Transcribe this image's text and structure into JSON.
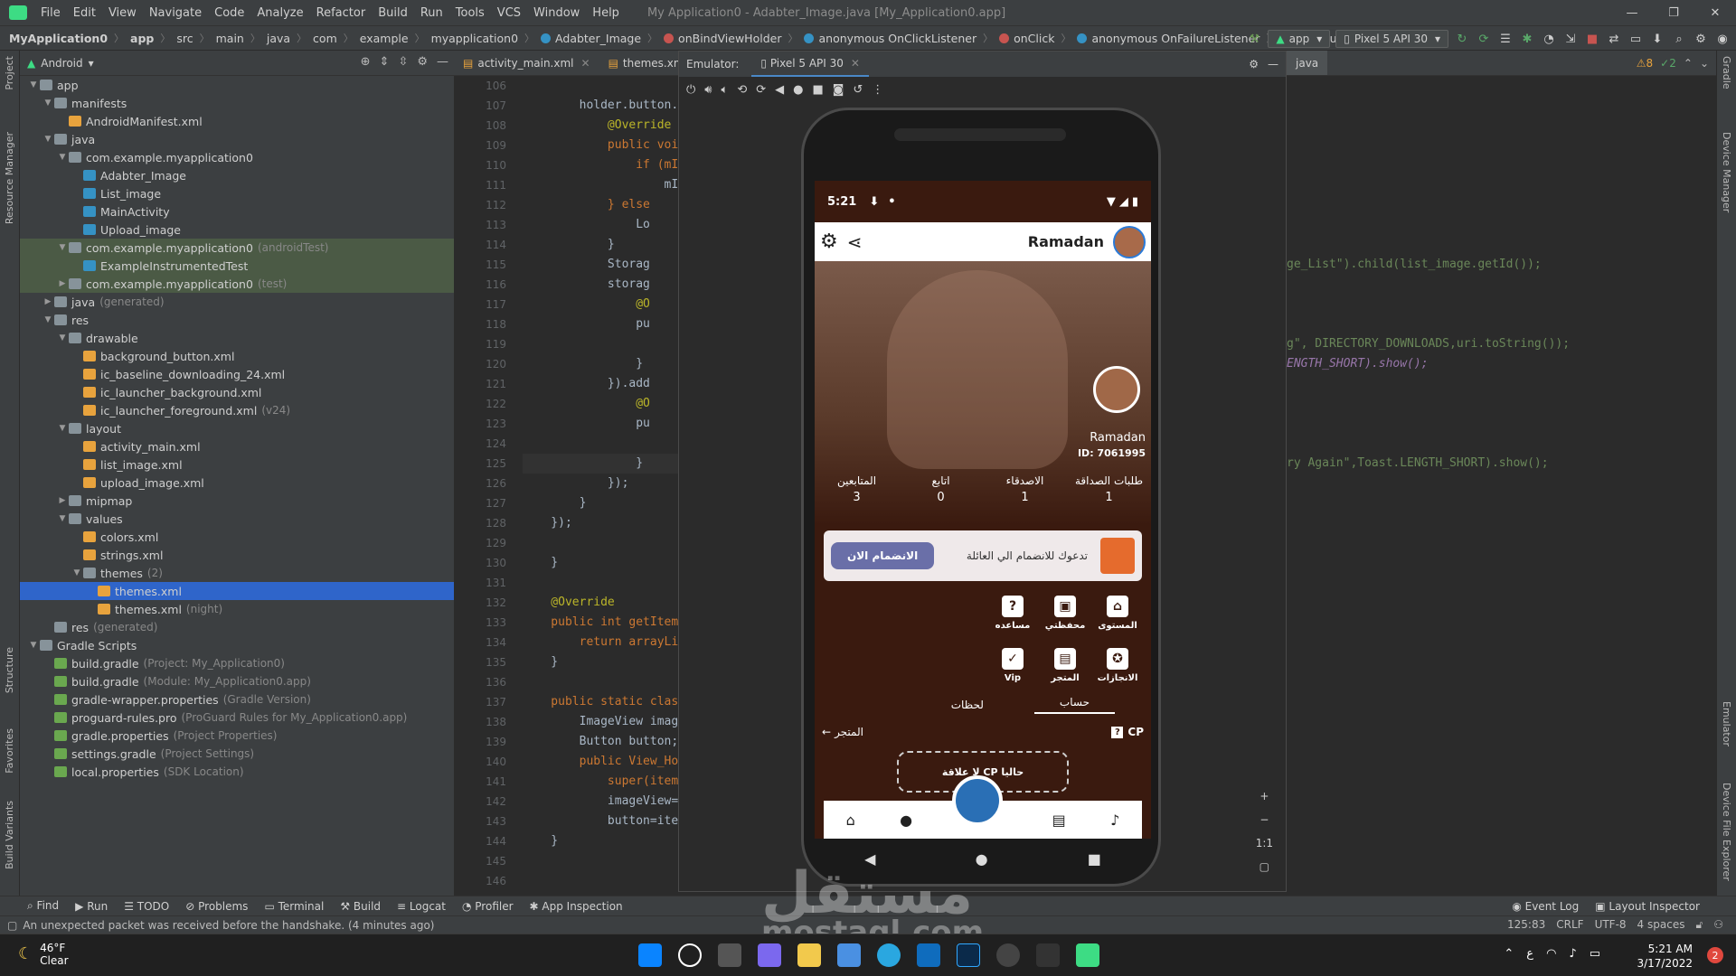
{
  "menubar": {
    "items": [
      "File",
      "Edit",
      "View",
      "Navigate",
      "Code",
      "Analyze",
      "Refactor",
      "Build",
      "Run",
      "Tools",
      "VCS",
      "Window",
      "Help"
    ],
    "window_title": "My Application0 - Adabter_Image.java [My_Application0.app]"
  },
  "breadcrumbs": [
    "MyApplication0",
    "app",
    "src",
    "main",
    "java",
    "com",
    "example",
    "myapplication0",
    "Adabter_Image",
    "onBindViewHolder",
    "anonymous OnClickListener",
    "onClick",
    "anonymous OnFailureListener",
    "onFailure"
  ],
  "toolbar": {
    "module": "app",
    "device": "Pixel 5 API 30"
  },
  "project_panel": {
    "mode": "Android",
    "tree": [
      {
        "label": "app",
        "depth": 0,
        "arrow": "▼"
      },
      {
        "label": "manifests",
        "depth": 1,
        "arrow": "▼"
      },
      {
        "label": "AndroidManifest.xml",
        "depth": 2,
        "arrow": ""
      },
      {
        "label": "java",
        "depth": 1,
        "arrow": "▼"
      },
      {
        "label": "com.example.myapplication0",
        "depth": 2,
        "arrow": "▼"
      },
      {
        "label": "Adabter_Image",
        "depth": 3,
        "arrow": ""
      },
      {
        "label": "List_image",
        "depth": 3,
        "arrow": ""
      },
      {
        "label": "MainActivity",
        "depth": 3,
        "arrow": ""
      },
      {
        "label": "Upload_image",
        "depth": 3,
        "arrow": ""
      },
      {
        "label": "com.example.myapplication0",
        "depth": 2,
        "arrow": "▼",
        "note": "(androidTest)",
        "hl": true
      },
      {
        "label": "ExampleInstrumentedTest",
        "depth": 3,
        "arrow": "",
        "hl": true
      },
      {
        "label": "com.example.myapplication0",
        "depth": 2,
        "arrow": "▶",
        "note": "(test)",
        "hl": true
      },
      {
        "label": "java",
        "depth": 1,
        "arrow": "▶",
        "note": "(generated)"
      },
      {
        "label": "res",
        "depth": 1,
        "arrow": "▼"
      },
      {
        "label": "drawable",
        "depth": 2,
        "arrow": "▼"
      },
      {
        "label": "background_button.xml",
        "depth": 3,
        "arrow": ""
      },
      {
        "label": "ic_baseline_downloading_24.xml",
        "depth": 3,
        "arrow": ""
      },
      {
        "label": "ic_launcher_background.xml",
        "depth": 3,
        "arrow": ""
      },
      {
        "label": "ic_launcher_foreground.xml",
        "depth": 3,
        "arrow": "",
        "note": "(v24)"
      },
      {
        "label": "layout",
        "depth": 2,
        "arrow": "▼"
      },
      {
        "label": "activity_main.xml",
        "depth": 3,
        "arrow": ""
      },
      {
        "label": "list_image.xml",
        "depth": 3,
        "arrow": ""
      },
      {
        "label": "upload_image.xml",
        "depth": 3,
        "arrow": ""
      },
      {
        "label": "mipmap",
        "depth": 2,
        "arrow": "▶"
      },
      {
        "label": "values",
        "depth": 2,
        "arrow": "▼"
      },
      {
        "label": "colors.xml",
        "depth": 3,
        "arrow": ""
      },
      {
        "label": "strings.xml",
        "depth": 3,
        "arrow": ""
      },
      {
        "label": "themes",
        "depth": 3,
        "arrow": "▼",
        "note": "(2)"
      },
      {
        "label": "themes.xml",
        "depth": 4,
        "arrow": "",
        "sel": true
      },
      {
        "label": "themes.xml",
        "depth": 4,
        "arrow": "",
        "note": "(night)"
      },
      {
        "label": "res",
        "depth": 1,
        "arrow": "",
        "note": "(generated)"
      },
      {
        "label": "Gradle Scripts",
        "depth": 0,
        "arrow": "▼"
      },
      {
        "label": "build.gradle",
        "depth": 1,
        "arrow": "",
        "note": "(Project: My_Application0)"
      },
      {
        "label": "build.gradle",
        "depth": 1,
        "arrow": "",
        "note": "(Module: My_Application0.app)"
      },
      {
        "label": "gradle-wrapper.properties",
        "depth": 1,
        "arrow": "",
        "note": "(Gradle Version)"
      },
      {
        "label": "proguard-rules.pro",
        "depth": 1,
        "arrow": "",
        "note": "(ProGuard Rules for My_Application0.app)"
      },
      {
        "label": "gradle.properties",
        "depth": 1,
        "arrow": "",
        "note": "(Project Properties)"
      },
      {
        "label": "settings.gradle",
        "depth": 1,
        "arrow": "",
        "note": "(Project Settings)"
      },
      {
        "label": "local.properties",
        "depth": 1,
        "arrow": "",
        "note": "(SDK Location)"
      }
    ]
  },
  "left_strip": {
    "project": "Project",
    "resource_manager": "Resource Manager",
    "structure": "Structure",
    "favorites": "Favorites",
    "build_variants": "Build Variants"
  },
  "right_strip": {
    "gradle": "Gradle",
    "device_manager": "Device Manager",
    "emulator": "Emulator",
    "device_file_explorer": "Device File Explorer"
  },
  "editor": {
    "tabs": [
      "activity_main.xml",
      "themes.xml"
    ],
    "right_tab": "java",
    "line_numbers": [
      106,
      107,
      108,
      109,
      110,
      111,
      112,
      113,
      114,
      115,
      116,
      117,
      118,
      119,
      120,
      121,
      122,
      123,
      124,
      125,
      126,
      127,
      128,
      129,
      130,
      131,
      132,
      133,
      134,
      135,
      136,
      137,
      138,
      139,
      140,
      141,
      142,
      143,
      144,
      145,
      146
    ],
    "code_left": [
      "",
      "        holder.button.",
      "            @Override",
      "            public voi",
      "                if (mI",
      "                    mI",
      "            } else",
      "                Lo",
      "            }",
      "            Storag",
      "            storag",
      "                @O",
      "                pu",
      "",
      "                }",
      "            }).add",
      "                @O",
      "                pu",
      "",
      "                }",
      "            });",
      "        }",
      "    });",
      "",
      "    }",
      "",
      "    @Override",
      "    public int getItem",
      "        return arrayLi",
      "    }",
      "",
      "    public static clas",
      "        ImageView imag",
      "        Button button;",
      "        public View_Ho",
      "            super(item",
      "            imageView=",
      "            button=ite",
      "    }",
      "",
      ""
    ],
    "code_right_1": "ge_List\").child(list_image.getId());",
    "code_right_2": "g\", DIRECTORY_DOWNLOADS,uri.toString());",
    "code_right_3": "ENGTH_SHORT).show();",
    "code_right_4": "ry Again\",Toast.LENGTH_SHORT).show();",
    "warnings": "⚠8",
    "weak_warnings": "✓2"
  },
  "emulator": {
    "label": "Emulator:",
    "tab": "Pixel 5 API 30",
    "zoom_ratio": "1:1",
    "status_time": "5:21",
    "app_title": "Ramadan",
    "profile_name": "Ramadan",
    "profile_id": "ID: 7061995",
    "stats": [
      {
        "label": "المتابعين",
        "value": "3"
      },
      {
        "label": "اتابع",
        "value": "0"
      },
      {
        "label": "الاصدقاء",
        "value": "1"
      },
      {
        "label": "طلبات الصداقة",
        "value": "1"
      }
    ],
    "join_button": "الانضمام الان",
    "join_text": "تدعوك للانضمام الي العائلة",
    "grid": [
      {
        "label": "مساعده",
        "icon": "?"
      },
      {
        "label": "محفظتي",
        "icon": "▣"
      },
      {
        "label": "المستوى",
        "icon": "⌂"
      },
      {
        "label": "Vip",
        "icon": "✓"
      },
      {
        "label": "المتجر",
        "icon": "▤"
      },
      {
        "label": "الانجازات",
        "icon": "✪"
      }
    ],
    "profile_tabs": [
      "لحظات",
      "حساب"
    ],
    "store_label": "المتجر",
    "cp_label": "CP",
    "cp_box": "لا علاقة CP حاليا"
  },
  "bottom_tools": [
    "Find",
    "Run",
    "TODO",
    "Problems",
    "Terminal",
    "Build",
    "Logcat",
    "Profiler",
    "App Inspection"
  ],
  "bottom_tools_right": [
    "Event Log",
    "Layout Inspector"
  ],
  "statusbar": {
    "message": "An unexpected packet was received before the handshake. (4 minutes ago)",
    "position": "125:83",
    "line_sep": "CRLF",
    "encoding": "UTF-8",
    "indent": "4 spaces"
  },
  "taskbar": {
    "temp": "46°F",
    "weather": "Clear",
    "time": "5:21 AM",
    "date": "3/17/2022",
    "notif": "2",
    "lang": "ع"
  },
  "watermark": {
    "ar": "مستقل",
    "en": "mostaql.com"
  }
}
